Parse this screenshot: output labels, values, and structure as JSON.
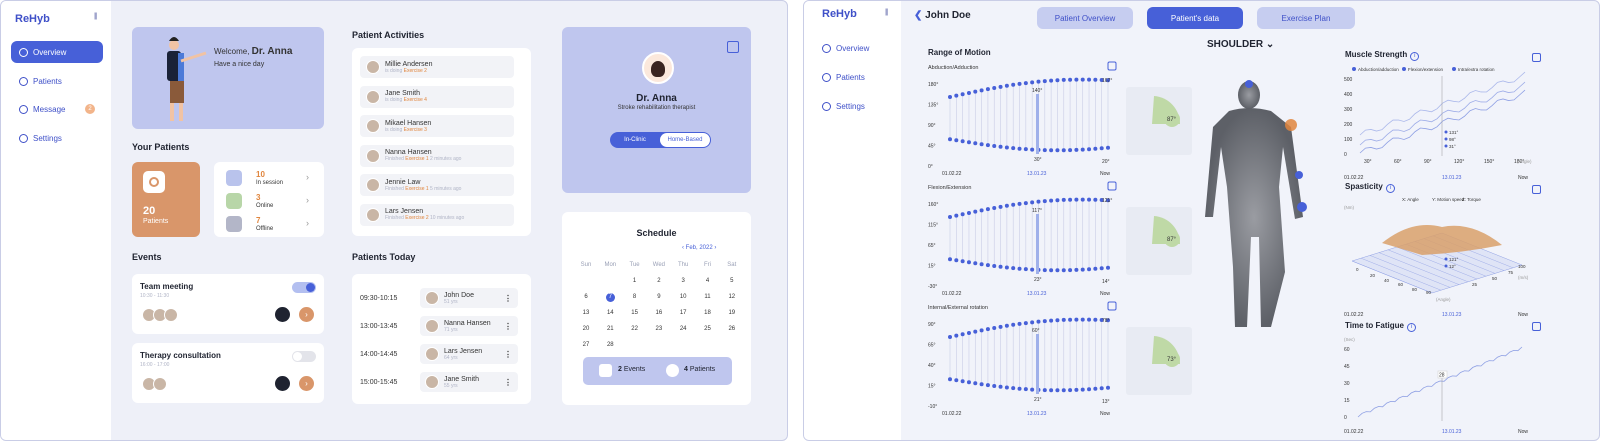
{
  "left": {
    "logo": "ReHyb",
    "nav": [
      {
        "label": "Overview",
        "icon": "pie-icon"
      },
      {
        "label": "Patients",
        "icon": "user-icon"
      },
      {
        "label": "Message",
        "icon": "chat-icon",
        "badge": "2"
      },
      {
        "label": "Settings",
        "icon": "gear-icon"
      }
    ],
    "welcome": {
      "prefix": "Welcome,",
      "name": "Dr. Anna",
      "sub": "Have a nice day"
    },
    "your_patients": {
      "title": "Your Patients",
      "total": "20",
      "total_label": "Patients",
      "stats": [
        {
          "count": "10",
          "label": "In session",
          "color": "#e0853d"
        },
        {
          "count": "3",
          "label": "Online",
          "color": "#e0853d"
        },
        {
          "count": "7",
          "label": "Offline",
          "color": "#e0853d"
        }
      ]
    },
    "events": {
      "title": "Events",
      "items": [
        {
          "name": "Team meeting",
          "time": "10:30 - 11:30",
          "on": true
        },
        {
          "name": "Therapy consultation",
          "time": "16:00 - 17:00",
          "on": false
        }
      ]
    },
    "activities": {
      "title": "Patient Activities",
      "items": [
        {
          "name": "Millie Andersen",
          "status": "is doing",
          "ex": "Exercise 2",
          "tail": ""
        },
        {
          "name": "Jane Smith",
          "status": "is doing",
          "ex": "Exercise 4",
          "tail": ""
        },
        {
          "name": "Mikael Hansen",
          "status": "is doing",
          "ex": "Exercise 3",
          "tail": ""
        },
        {
          "name": "Nanna Hansen",
          "status": "Finished",
          "ex": "Exercise 1",
          "tail": "2 minutes ago"
        },
        {
          "name": "Jennie Law",
          "status": "Finished",
          "ex": "Exercise 1",
          "tail": "5 minutes ago"
        },
        {
          "name": "Lars Jensen",
          "status": "Finished",
          "ex": "Exercise 2",
          "tail": "10 minutes ago"
        }
      ]
    },
    "today": {
      "title": "Patients Today",
      "items": [
        {
          "time": "09:30-10:15",
          "name": "John Doe",
          "age": "51 yrs"
        },
        {
          "time": "13:00-13:45",
          "name": "Nanna Hansen",
          "age": "71 yrs"
        },
        {
          "time": "14:00-14:45",
          "name": "Lars Jensen",
          "age": "64 yrs"
        },
        {
          "time": "15:00-15:45",
          "name": "Jane Smith",
          "age": "55 yrs"
        }
      ]
    },
    "profile": {
      "name": "Dr. Anna",
      "role": "Stroke rehabilitation therapist",
      "toggle": [
        "In-Clinic",
        "Home-Based"
      ]
    },
    "schedule": {
      "title": "Schedule",
      "month": "Feb, 2022",
      "days": [
        "Sun",
        "Mon",
        "Tue",
        "Wed",
        "Thu",
        "Fri",
        "Sat"
      ],
      "weeks": [
        [
          "",
          "",
          "1",
          "2",
          "3",
          "4",
          "5"
        ],
        [
          "6",
          "7",
          "8",
          "9",
          "10",
          "11",
          "12"
        ],
        [
          "13",
          "14",
          "15",
          "16",
          "17",
          "18",
          "19"
        ],
        [
          "20",
          "21",
          "22",
          "23",
          "24",
          "25",
          "26"
        ],
        [
          "27",
          "28",
          "",
          "",
          "",
          "",
          ""
        ]
      ],
      "selected": "7",
      "events_count": "2",
      "events_label": "Events",
      "patients_count": "4",
      "patients_label": "Patients"
    }
  },
  "right": {
    "logo": "ReHyb",
    "nav": [
      {
        "label": "Overview",
        "icon": "pie-icon"
      },
      {
        "label": "Patients",
        "icon": "user-icon"
      },
      {
        "label": "Settings",
        "icon": "gear-icon"
      }
    ],
    "patient": "John Doe",
    "tabs": [
      "Patient Overview",
      "Patient's data",
      "Exercise Plan"
    ],
    "body_part": "SHOULDER",
    "rom": {
      "title": "Range of Motion",
      "charts": [
        {
          "label": "Abduction/Adduction",
          "yticks": [
            "180°",
            "135°",
            "90°",
            "45°",
            "0°"
          ],
          "start": "01.02.22",
          "mid": "13.01.23",
          "end": "Now",
          "hi": "140°",
          "lo": "30°",
          "right_hi": "167°",
          "right_lo": "20°",
          "angle": "87°"
        },
        {
          "label": "Flexion/Extension",
          "yticks": [
            "160°",
            "115°",
            "65°",
            "15°",
            "-30°"
          ],
          "start": "01.02.22",
          "mid": "13.01.23",
          "end": "Now",
          "hi": "117°",
          "lo": "23°",
          "right_hi": "121°",
          "right_lo": "14°",
          "angle": "87°"
        },
        {
          "label": "Internal/External rotation",
          "yticks": [
            "90°",
            "65°",
            "40°",
            "15°",
            "-10°"
          ],
          "start": "01.02.22",
          "mid": "13.01.23",
          "end": "Now",
          "hi": "60°",
          "lo": "21°",
          "right_hi": "78°",
          "right_lo": "13°",
          "angle": "73°"
        }
      ]
    },
    "muscle": {
      "title": "Muscle Strength",
      "legend": [
        "Abduction/adduction",
        "Flexion/extension",
        "Intra/extra rotation"
      ],
      "yticks": [
        "500",
        "400",
        "300",
        "200",
        "100",
        "0"
      ],
      "xticks": [
        "30°",
        "60°",
        "90°",
        "120°",
        "150°",
        "180°"
      ],
      "xunit": "(Angle)",
      "values": [
        "131°",
        "98°",
        "31°"
      ],
      "start": "01.02.22",
      "mid": "13.01.23",
      "end": "Now"
    },
    "spasticity": {
      "title": "Spasticity",
      "legend": [
        "X: Angle",
        "Y: Motion speed",
        "Z: Torque"
      ],
      "zunit": "(Nm)",
      "axis": [
        "0",
        "20",
        "40",
        "60",
        "80",
        "90",
        "25",
        "50",
        "75",
        "100"
      ],
      "xunit": "(Angle)",
      "yunit": "(m/s)",
      "values": [
        "121°",
        "12°"
      ],
      "start": "01.02.22",
      "mid": "13.01.23",
      "end": "Now"
    },
    "fatigue": {
      "title": "Time to Fatigue",
      "unit": "(Sec)",
      "yticks": [
        "60",
        "45",
        "30",
        "15",
        "0"
      ],
      "value": "28",
      "start": "01.02.22",
      "mid": "13.01.23",
      "end": "Now"
    }
  }
}
